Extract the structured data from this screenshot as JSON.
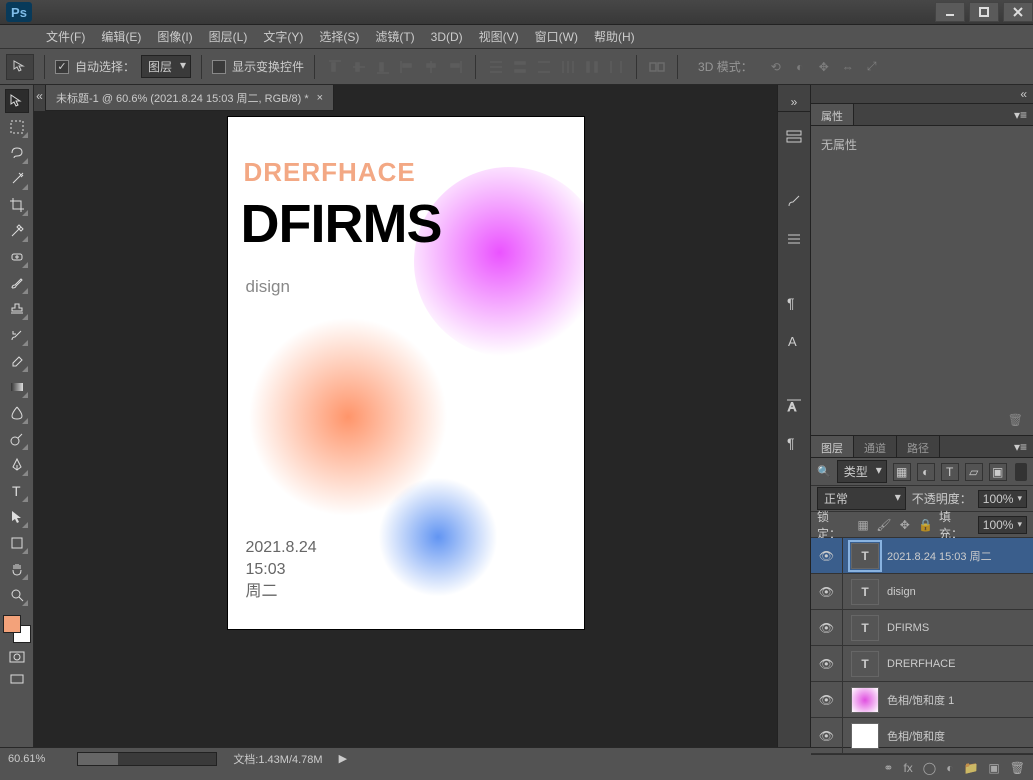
{
  "titlebar": {
    "min": "—",
    "max": "▢",
    "close": "✕"
  },
  "menu": [
    "文件(F)",
    "编辑(E)",
    "图像(I)",
    "图层(L)",
    "文字(Y)",
    "选择(S)",
    "滤镜(T)",
    "3D(D)",
    "视图(V)",
    "窗口(W)",
    "帮助(H)"
  ],
  "options": {
    "auto_select": "自动选择：",
    "scope": "图层",
    "show_transform": "显示变换控件",
    "mode_3d": "3D 模式："
  },
  "doc_tab": {
    "title": "未标题-1 @ 60.6% (2021.8.24 15:03 周二, RGB/8) *",
    "close": "×"
  },
  "canvas": {
    "t1": "DRERFHACE",
    "t2": "DFIRMS",
    "t3": "disign",
    "date": "2021.8.24",
    "time": "15:03",
    "day": "周二"
  },
  "panels": {
    "properties": "属性",
    "no_props": "无属性",
    "layers": "图层",
    "channels": "通道",
    "paths": "路径",
    "kind": "类型",
    "blend": "正常",
    "opacity_label": "不透明度：",
    "opacity": "100%",
    "lock_label": "锁定：",
    "fill_label": "填充：",
    "fill": "100%"
  },
  "layers": [
    {
      "name": "2021.8.24  15:03 周二",
      "type": "T",
      "sel": true
    },
    {
      "name": "disign",
      "type": "T"
    },
    {
      "name": "DFIRMS",
      "type": "T"
    },
    {
      "name": "DRERFHACE",
      "type": "T"
    },
    {
      "name": "色相/饱和度  1",
      "type": "adj"
    },
    {
      "name": "色相/饱和度",
      "type": "adj2"
    }
  ],
  "status": {
    "zoom": "60.61%",
    "doc": "文档:1.43M/4.78M"
  }
}
